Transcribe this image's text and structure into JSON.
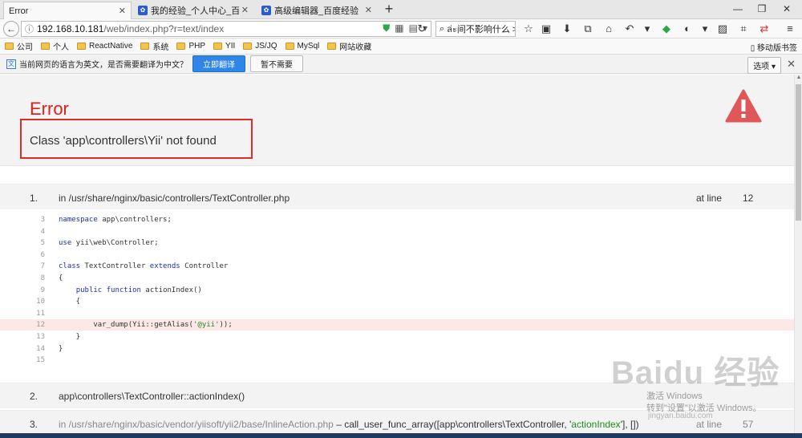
{
  "tabs": [
    {
      "label": "Error",
      "active": true
    },
    {
      "label": "我的经验_个人中心_百度经",
      "active": false
    },
    {
      "label": "高级编辑器_百度经验",
      "active": false
    }
  ],
  "window_controls": {
    "minimize": "—",
    "restore": "❐",
    "close": "✕"
  },
  "nav": {
    "url_host": "192.168.10.181",
    "url_path": "/web/index.php?r=text/index",
    "search_value": "ล่ะ间不影响什么 >"
  },
  "bookmarks": {
    "items": [
      "公司",
      "个人",
      "ReactNative",
      "系统",
      "PHP",
      "YII",
      "JS/JQ",
      "MySql",
      "网站收藏"
    ],
    "mobile": "移动版书签"
  },
  "translate_bar": {
    "message": "当前网页的语言为英文，是否需要翻译为中文？",
    "translate_btn": "立即翻译",
    "not_needed_btn": "暂不需要",
    "options_btn": "选项 ▾"
  },
  "error": {
    "title": "Error",
    "message": "Class 'app\\controllers\\Yii' not found"
  },
  "trace": [
    {
      "num": "1.",
      "text": "in /usr/share/nginx/basic/controllers/TextController.php",
      "at_line": "at line",
      "line": "12"
    },
    {
      "num": "2.",
      "text": "app\\controllers\\TextController::actionIndex()",
      "at_line": "",
      "line": ""
    },
    {
      "num": "3.",
      "text_pre": "in /usr/share/nginx/basic/vendor/yiisoft/yii2/base/InlineAction.php",
      "text_mid": " – call_user_func_array([app\\controllers\\TextController, '",
      "text_str": "actionIndex",
      "text_post": "'], [])",
      "at_line": "at line",
      "line": "57"
    }
  ],
  "code": [
    {
      "ln": "3",
      "parts": [
        {
          "t": "namespace",
          "c": "kw"
        },
        {
          "t": " app\\controllers;",
          "c": ""
        }
      ]
    },
    {
      "ln": "4",
      "parts": []
    },
    {
      "ln": "5",
      "parts": [
        {
          "t": "use",
          "c": "kw"
        },
        {
          "t": " yii\\web\\Controller;",
          "c": ""
        }
      ]
    },
    {
      "ln": "6",
      "parts": []
    },
    {
      "ln": "7",
      "parts": [
        {
          "t": "class",
          "c": "kw"
        },
        {
          "t": " TextController ",
          "c": ""
        },
        {
          "t": "extends",
          "c": "kw"
        },
        {
          "t": " Controller",
          "c": ""
        }
      ]
    },
    {
      "ln": "8",
      "parts": [
        {
          "t": "{",
          "c": ""
        }
      ]
    },
    {
      "ln": "9",
      "parts": [
        {
          "t": "    ",
          "c": ""
        },
        {
          "t": "public",
          "c": "kw"
        },
        {
          "t": " ",
          "c": ""
        },
        {
          "t": "function",
          "c": "kw"
        },
        {
          "t": " actionIndex()",
          "c": ""
        }
      ]
    },
    {
      "ln": "10",
      "parts": [
        {
          "t": "    {",
          "c": ""
        }
      ]
    },
    {
      "ln": "11",
      "parts": []
    },
    {
      "ln": "12",
      "hl": true,
      "parts": [
        {
          "t": "        var_dump(Yii::getAlias(",
          "c": ""
        },
        {
          "t": "'@yii'",
          "c": "hl-str"
        },
        {
          "t": "));",
          "c": ""
        }
      ]
    },
    {
      "ln": "13",
      "parts": [
        {
          "t": "    }",
          "c": ""
        }
      ]
    },
    {
      "ln": "14",
      "parts": [
        {
          "t": "}",
          "c": ""
        }
      ]
    },
    {
      "ln": "15",
      "parts": []
    }
  ],
  "watermark": {
    "brand": "Baidu 经验",
    "sub": "jingyan.baidu.com"
  },
  "activation": {
    "line1": "激活 Windows",
    "line2": "转到\"设置\"以激活 Windows。"
  },
  "colors": {
    "error_red": "#e0201b",
    "accent_blue": "#2f86e6",
    "keyword_blue": "#1d2fb5",
    "string_green": "#1b8c1b",
    "highlight_row": "#fde8e8"
  }
}
